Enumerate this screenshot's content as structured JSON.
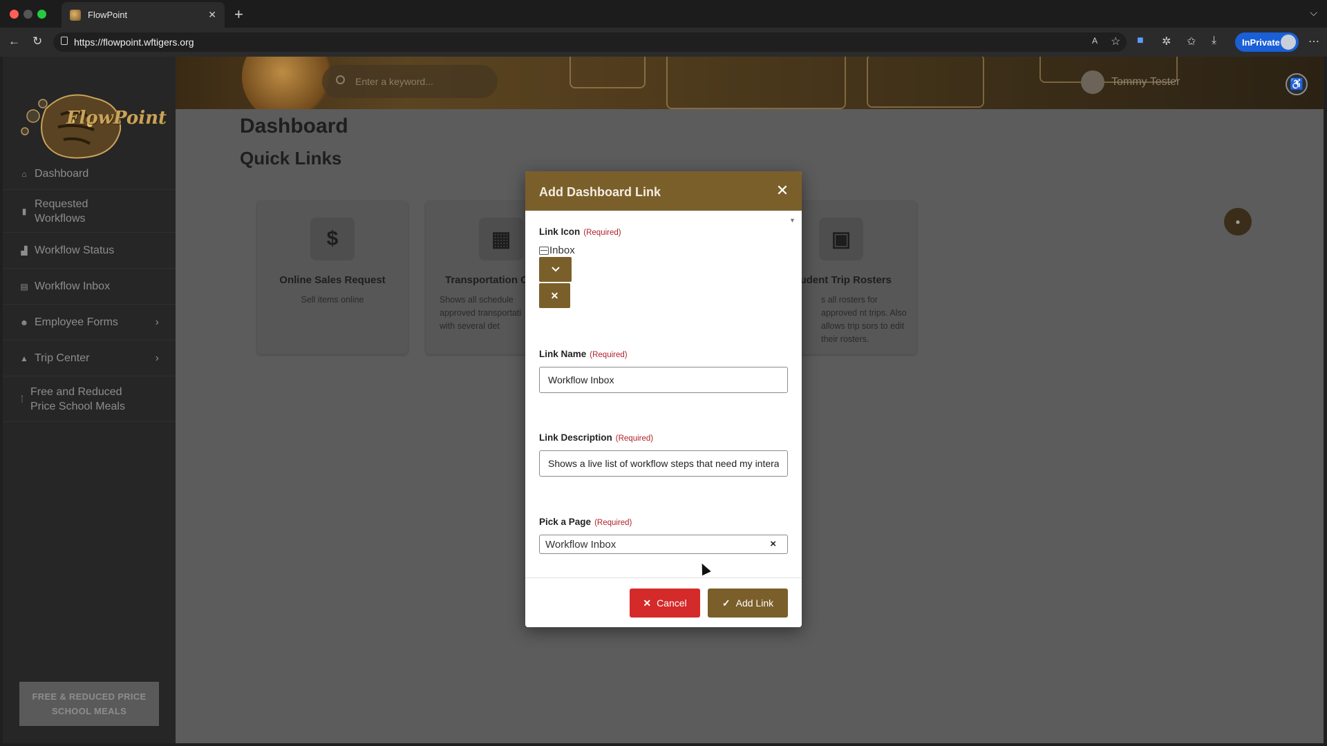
{
  "browser": {
    "tab_title": "FlowPoint",
    "url": "https://flowpoint.wftigers.org",
    "inprivate_label": "InPrivate"
  },
  "app": {
    "logo_text": "FlowPoint",
    "search_placeholder": "Enter a keyword...",
    "user_name": "Tommy Tester"
  },
  "sidebar": {
    "items": [
      {
        "label": "Dashboard",
        "icon": "home-icon"
      },
      {
        "label": "Requested Workflows",
        "icon": "document-icon"
      },
      {
        "label": "Workflow Status",
        "icon": "chart-icon"
      },
      {
        "label": "Workflow Inbox",
        "icon": "inbox-icon"
      },
      {
        "label": "Employee Forms",
        "icon": "people-icon",
        "has_submenu": true
      },
      {
        "label": "Trip Center",
        "icon": "road-icon",
        "has_submenu": true
      },
      {
        "label": "Free and Reduced Price School Meals",
        "icon": "fork-icon"
      }
    ],
    "bottom_button": "FREE & REDUCED PRICE SCHOOL MEALS"
  },
  "main": {
    "page_title": "Dashboard",
    "section_title": "Quick Links",
    "cards": [
      {
        "icon": "dollar-icon",
        "title": "Online Sales Request",
        "desc": "Sell items online"
      },
      {
        "icon": "calendar-icon",
        "title": "Transportation Ca",
        "desc": "Shows all schedule approved transportati with several det"
      },
      {
        "icon": "clipboard-icon",
        "title": "udent Trip Rosters",
        "desc": "s all rosters for approved nt trips. Also allows trip sors to edit their rosters."
      }
    ]
  },
  "modal": {
    "title": "Add Dashboard Link",
    "required_tag": "(Required)",
    "link_icon_label": "Link Icon",
    "link_icon_value": "Inbox",
    "link_name_label": "Link Name",
    "link_name_value": "Workflow Inbox",
    "link_desc_label": "Link Description",
    "link_desc_value": "Shows a live list of workflow steps that need my interaction",
    "page_label": "Pick a Page",
    "page_value": "Workflow Inbox",
    "cancel_label": "Cancel",
    "add_label": "Add Link"
  },
  "colors": {
    "accent": "#7b5f2a",
    "danger": "#d42a2a",
    "sidebar_bg": "#262626",
    "overlay_bg": "#5c5c5c"
  }
}
